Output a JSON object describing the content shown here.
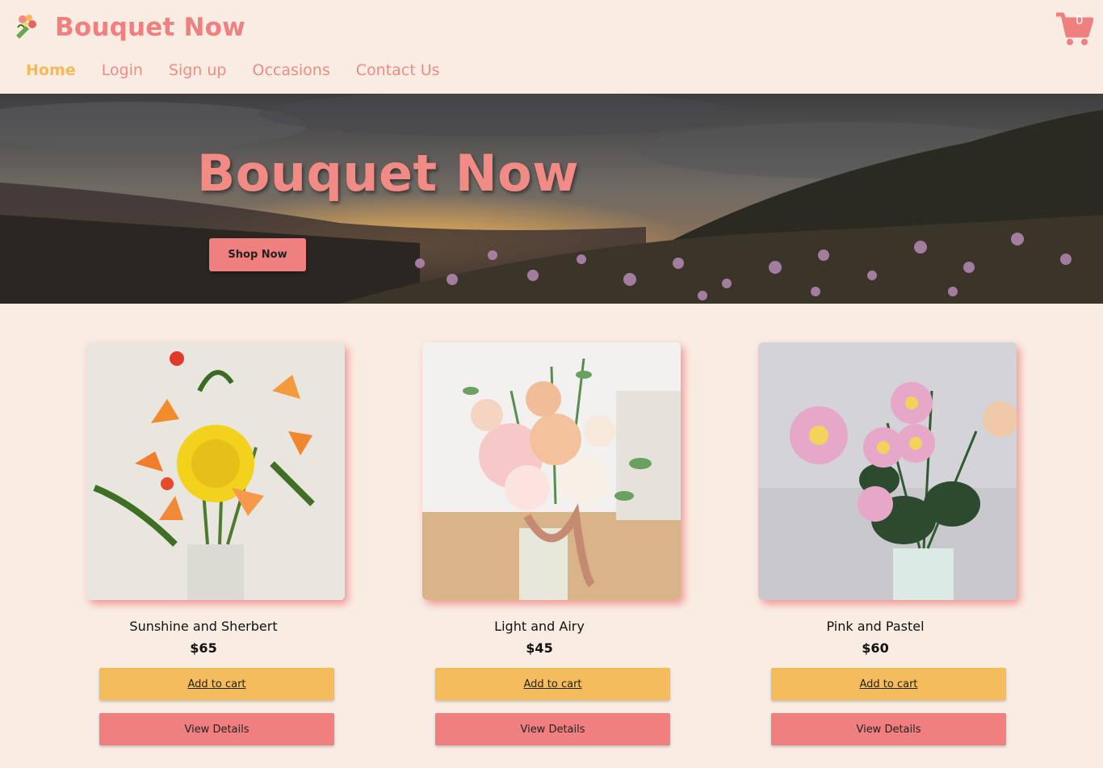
{
  "header": {
    "brand": "Bouquet Now",
    "logo_icon": "bouquet-icon",
    "cart_icon": "shopping-cart-icon",
    "cart_count": "0"
  },
  "nav": {
    "items": [
      {
        "label": "Home",
        "active": true
      },
      {
        "label": "Login"
      },
      {
        "label": "Sign up"
      },
      {
        "label": "Occasions"
      },
      {
        "label": "Contact Us"
      }
    ]
  },
  "hero": {
    "title": "Bouquet Now",
    "cta_label": "Shop Now"
  },
  "products": [
    {
      "name": "Sunshine and Sherbert",
      "price": "$65",
      "add_label": "Add to cart",
      "details_label": "View Details"
    },
    {
      "name": "Light and Airy",
      "price": "$45",
      "add_label": "Add to cart",
      "details_label": "View Details"
    },
    {
      "name": "Pink and Pastel",
      "price": "$60",
      "add_label": "Add to cart",
      "details_label": "View Details"
    }
  ],
  "colors": {
    "background": "#f9ede3",
    "brand": "#f08080",
    "active_nav": "#f5b957",
    "add_button": "#f5bc5c",
    "details_button": "#f08080"
  }
}
